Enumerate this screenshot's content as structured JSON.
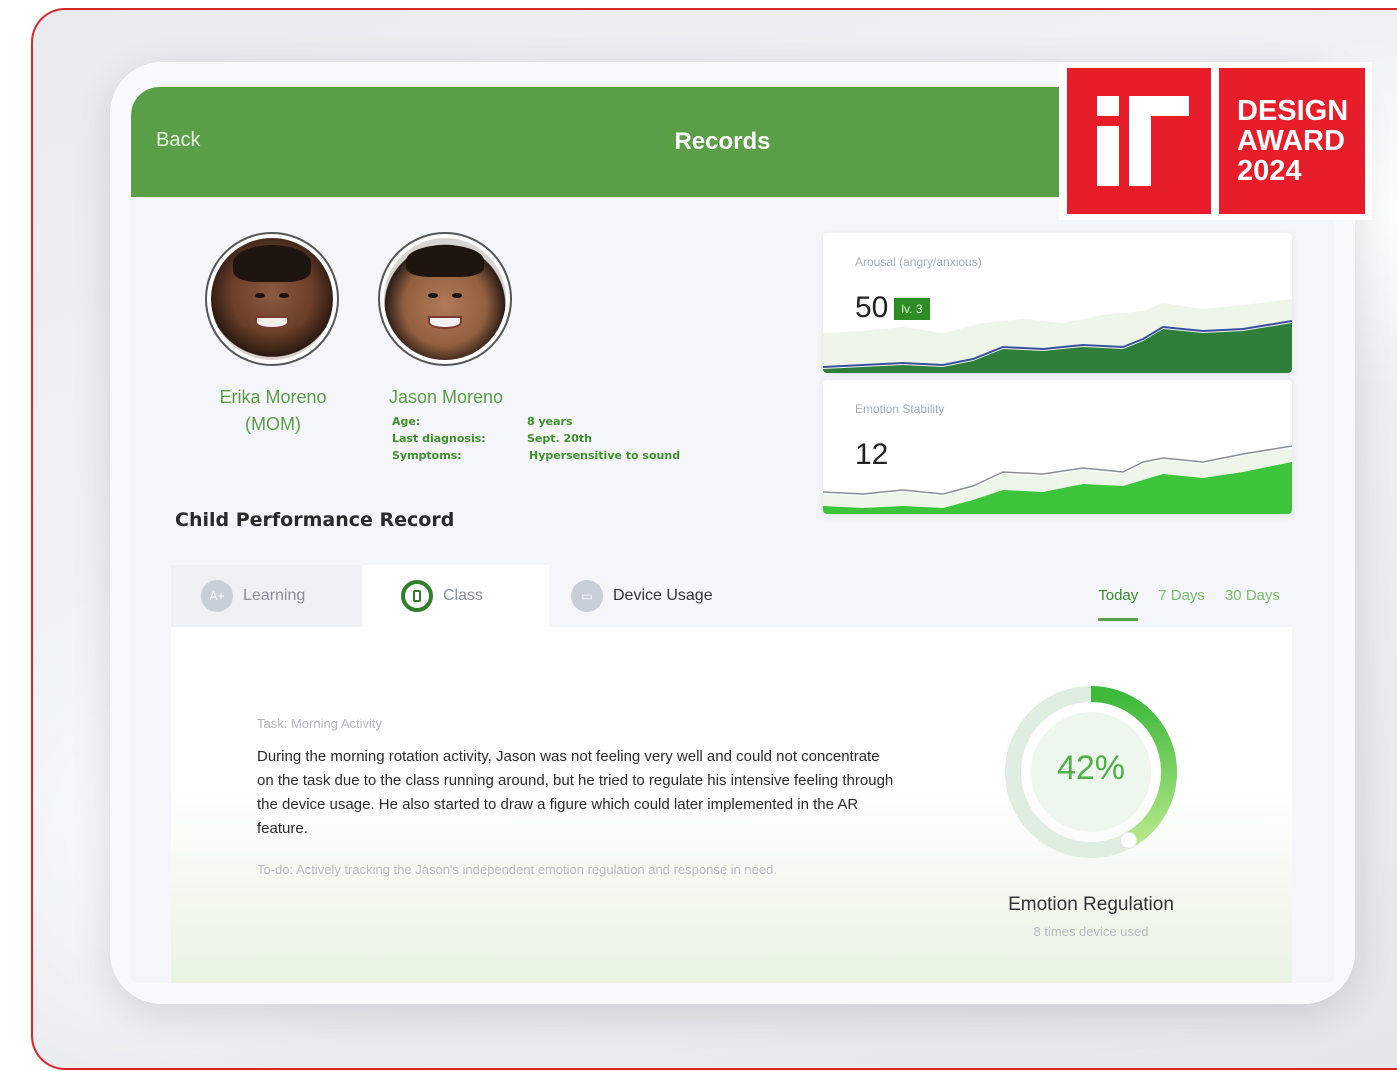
{
  "header": {
    "back_label": "Back",
    "title": "Records"
  },
  "award": {
    "line1": "DESIGN",
    "line2": "AWARD",
    "line3": "2024",
    "logo_text": "iF"
  },
  "parent": {
    "name": "Erika Moreno",
    "role": "(MOM)"
  },
  "child": {
    "name": "Jason Moreno",
    "details": [
      {
        "label": "Age:",
        "value": "8 years"
      },
      {
        "label": "Last diagnosis:",
        "value": "Sept. 20th"
      },
      {
        "label": "Symptoms:",
        "value": "Hypersensitive to sound"
      }
    ]
  },
  "metrics": {
    "arousal": {
      "label": "Arousal (angry/anxious)",
      "value": "50",
      "badge": "lv. 3"
    },
    "stability": {
      "label": "Emotion Stability",
      "value": "12"
    }
  },
  "section_title": "Child Performance Record",
  "tabs": [
    {
      "label": "Learning",
      "icon": "A+"
    },
    {
      "label": "Class",
      "icon": "class-icon"
    },
    {
      "label": "Device Usage",
      "icon": "device-icon"
    }
  ],
  "periods": [
    "Today",
    "7 Days",
    "30 Days"
  ],
  "task": {
    "label": "Task: Morning Activity",
    "text": "During the morning rotation activity, Jason was not feeling very well and could not concentrate on the task due to the class running around, but he tried to regulate his intensive feeling through the device usage. He also started to draw a figure which could later implemented in the AR feature.",
    "todo": "To-do: Actively tracking the Jason's independent emotion regulation and response in need."
  },
  "gauge": {
    "value": "42%",
    "fraction": 0.42,
    "title": "Emotion Regulation",
    "subtitle": "8 times device used"
  },
  "colors": {
    "brand_green": "#5a9e48",
    "award_red": "#e81d2a",
    "dark_green": "#2f7f2a"
  }
}
